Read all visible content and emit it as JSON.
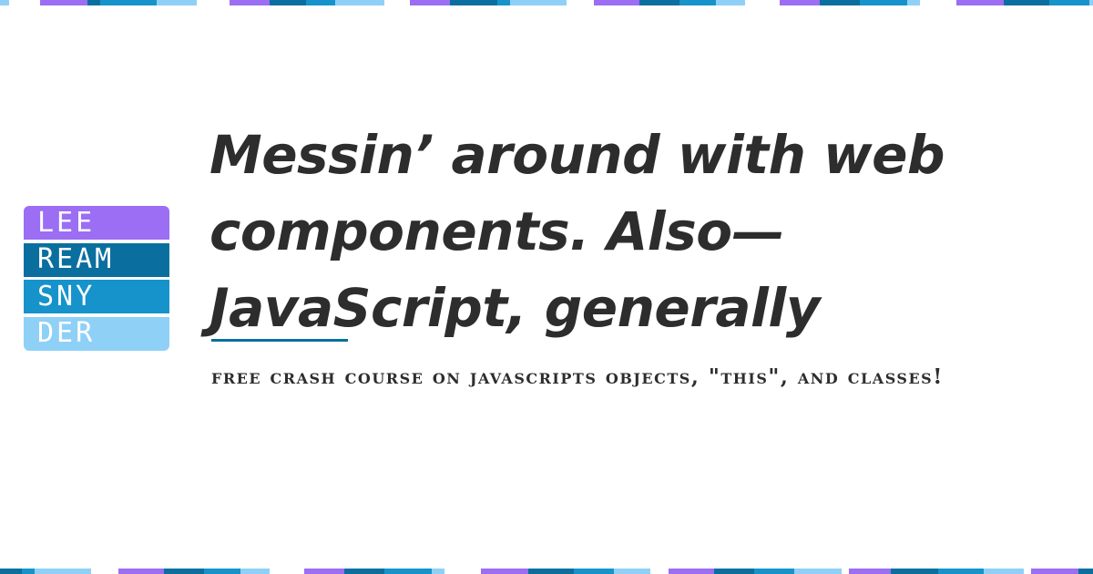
{
  "colors": {
    "purple": "#9b6ef3",
    "dark_blue": "#0a6f9f",
    "mid_blue": "#1793cc",
    "light_blue": "#8fd0f7",
    "text": "#2d2d2d",
    "background": "#ffffff"
  },
  "logo": {
    "lines": [
      "LEE",
      "REAM",
      "SNY",
      "DER"
    ]
  },
  "post": {
    "title_lines": [
      "Messin’ around with web",
      "components. Also—",
      "JavaScript, generally"
    ],
    "subtitle": "FREE CRASH COURSE ON JAVASCRIPTS OBJECTS, \"THIS\", AND CLASSES!"
  }
}
